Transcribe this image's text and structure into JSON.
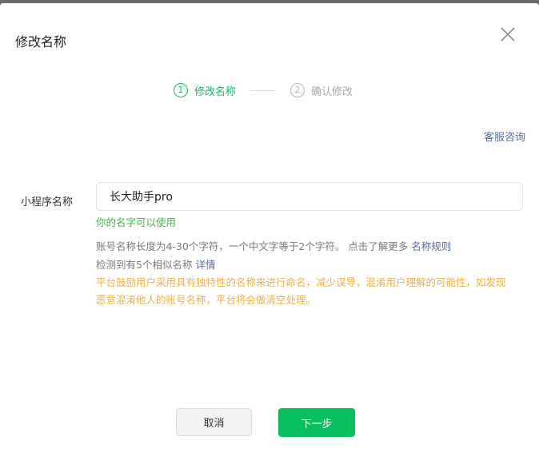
{
  "dialog": {
    "title": "修改名称"
  },
  "steps": [
    {
      "num": "1",
      "label": "修改名称"
    },
    {
      "num": "2",
      "label": "确认修改"
    }
  ],
  "service_link": "客服咨询",
  "form": {
    "label": "小程序名称",
    "value": "长大助手pro",
    "valid_msg": "你的名字可以使用"
  },
  "hints": {
    "rule_text": "账号名称长度为4-30个字符，一个中文字等于2个字符。 点击了解更多",
    "rule_link": "名称规则",
    "similar_text": "检测到有5个相似名称",
    "similar_link": "详情"
  },
  "warning": "平台鼓励用户采用具有独特性的名称来进行命名，减少误导，混淆用户理解的可能性，如发现恶意混淆他人的账号名称，平台将会做清空处理。",
  "buttons": {
    "cancel": "取消",
    "next": "下一步"
  },
  "colors": {
    "primary": "#07c160",
    "link": "#576b95",
    "success": "#4caf50",
    "warning": "#e6b24a"
  }
}
